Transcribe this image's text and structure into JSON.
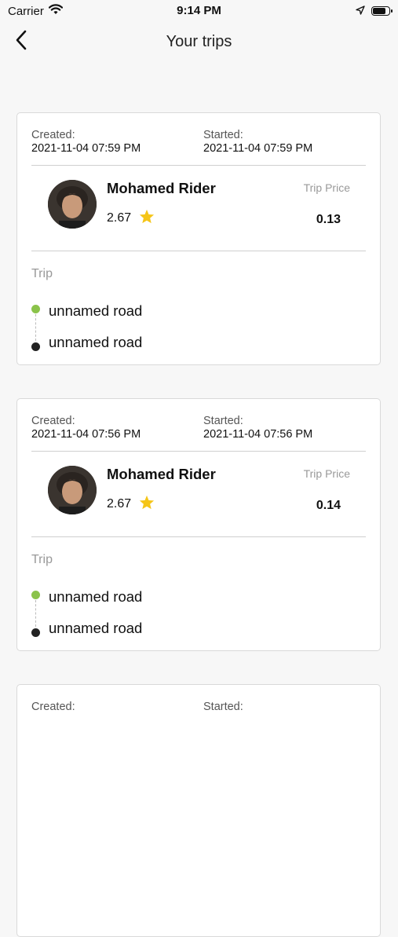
{
  "status_bar": {
    "carrier": "Carrier",
    "time": "9:14 PM",
    "battery_level": 0.9
  },
  "nav": {
    "title": "Your trips",
    "back_icon": "chevron-left-icon"
  },
  "colors": {
    "accent_green": "#8bc34a",
    "star_yellow": "#f5c518",
    "border": "#d9d9d9"
  },
  "trips": [
    {
      "created_label": "Created:",
      "created_value": "2021-11-04 07:59 PM",
      "started_label": "Started:",
      "started_value": "2021-11-04 07:59 PM",
      "rider_name": "Mohamed Rider",
      "rating": "2.67",
      "price_label": "Trip Price",
      "price": "0.13",
      "trip_label": "Trip",
      "pickup": "unnamed road",
      "dropoff": "unnamed road"
    },
    {
      "created_label": "Created:",
      "created_value": "2021-11-04 07:56 PM",
      "started_label": "Started:",
      "started_value": "2021-11-04 07:56 PM",
      "rider_name": "Mohamed Rider",
      "rating": "2.67",
      "price_label": "Trip Price",
      "price": "0.14",
      "trip_label": "Trip",
      "pickup": "unnamed road",
      "dropoff": "unnamed road"
    },
    {
      "created_label": "Created:",
      "created_value": "",
      "started_label": "Started:",
      "started_value": "",
      "rider_name": "",
      "rating": "",
      "price_label": "",
      "price": "",
      "trip_label": "",
      "pickup": "",
      "dropoff": ""
    }
  ]
}
